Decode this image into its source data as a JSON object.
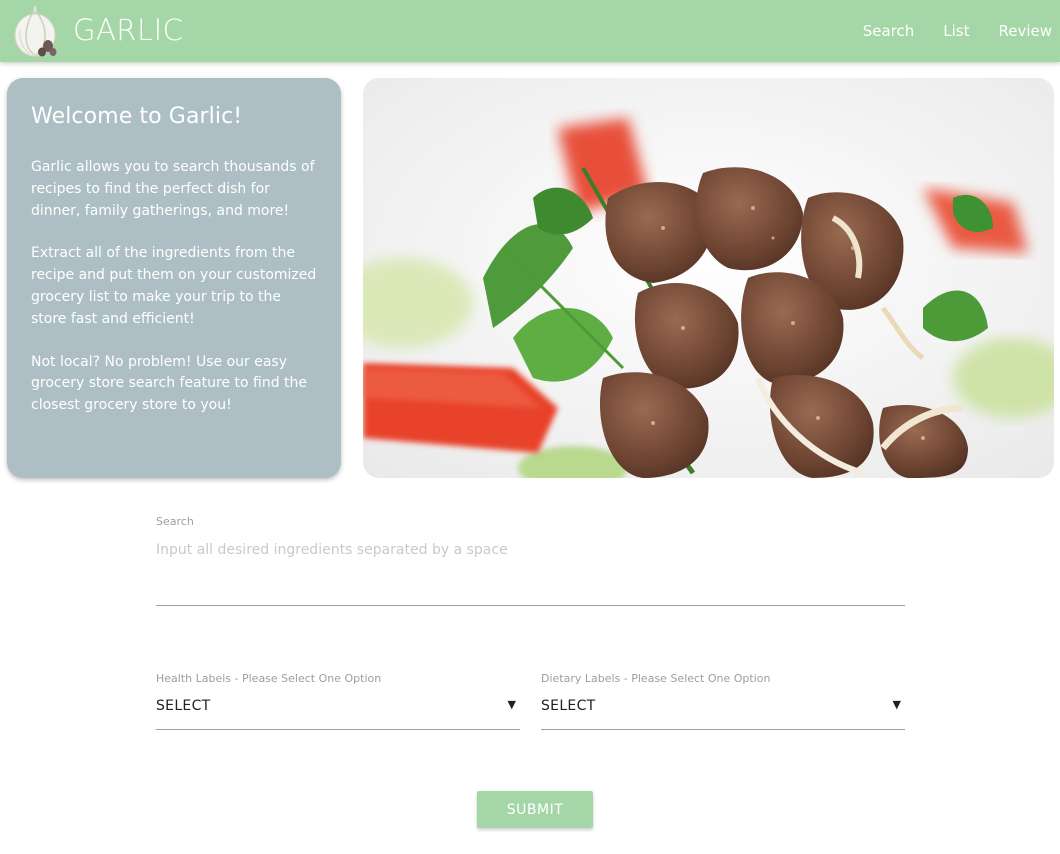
{
  "app": {
    "brand": "GARLIC"
  },
  "nav": {
    "items": [
      {
        "label": "Search"
      },
      {
        "label": "List"
      },
      {
        "label": "Review"
      }
    ]
  },
  "welcome": {
    "title": "Welcome to Garlic!",
    "paragraphs": [
      "Garlic allows you to search thousands of recipes to find the perfect dish for dinner, family gatherings, and more!",
      "Extract all of the ingredients from the recipe and put them on your customized grocery list to make your trip to the store fast and efficient!",
      "Not local? No problem! Use our easy grocery store search feature to find the closest grocery store to you!"
    ]
  },
  "hero": {
    "image_icon": "food-photo-steak-salad"
  },
  "search": {
    "label": "Search",
    "value": "",
    "placeholder": "Input all desired ingredients separated by a space"
  },
  "health_select": {
    "label": "Health Labels - Please Select One Option",
    "selected": "SELECT",
    "caret": "▼"
  },
  "dietary_select": {
    "label": "Dietary Labels - Please Select One Option",
    "selected": "SELECT",
    "caret": "▼"
  },
  "submit": {
    "label": "SUBMIT"
  },
  "colors": {
    "navbar": "#a5d6a7",
    "card": "#adbec5",
    "button": "#a5d6a7",
    "text_white": "#ffffff",
    "label_gray": "#9e9e9e"
  }
}
